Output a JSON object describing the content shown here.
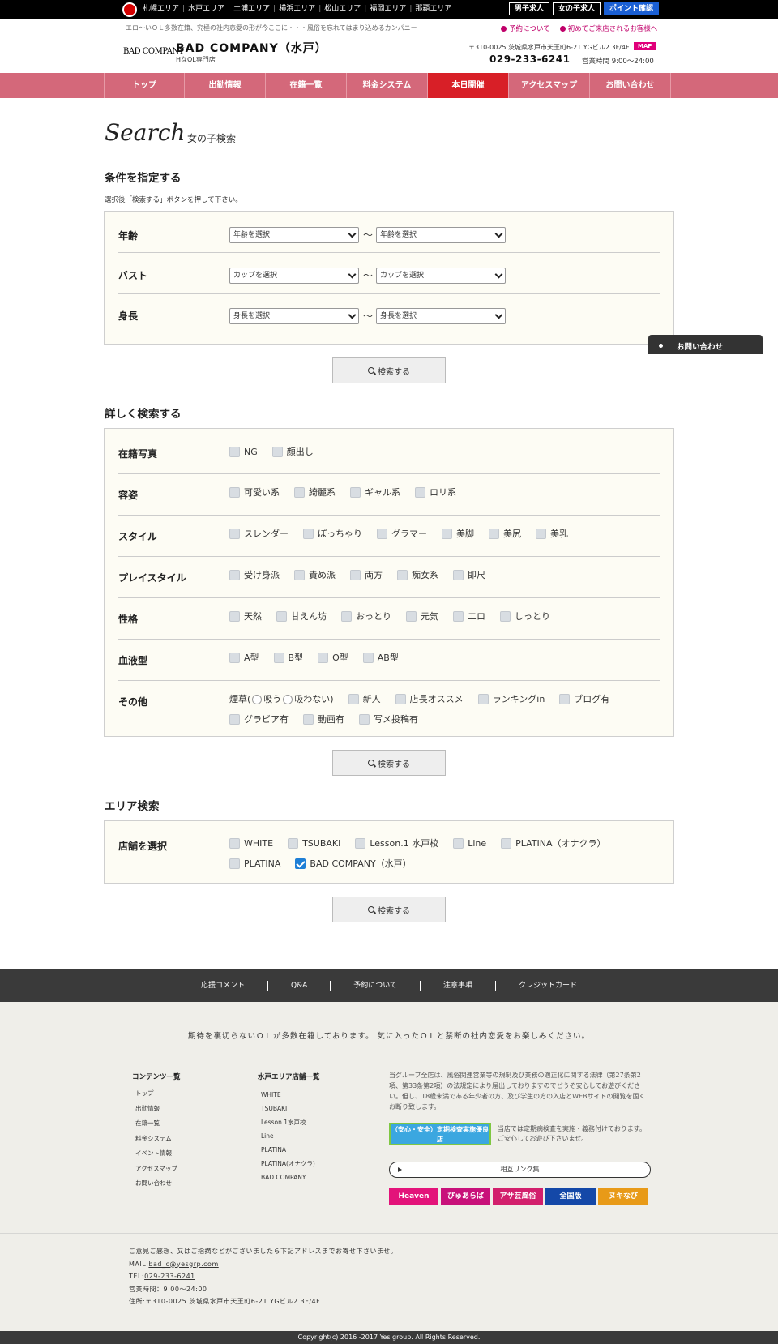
{
  "topbar": {
    "areas": [
      "札幌エリア",
      "水戸エリア",
      "土浦エリア",
      "横浜エリア",
      "松山エリア",
      "福岡エリア",
      "那覇エリア"
    ],
    "buttons": [
      "男子求人",
      "女の子求人",
      "ポイント確認"
    ]
  },
  "header": {
    "tagline": "エロ〜いＯＬ多数在籍、究極の社内恋愛の形が今ここに・・・風俗を忘れてはまり込めるカンパニー",
    "logo": "BAD COMPANY",
    "shop_name": "BAD COMPANY（水戸）",
    "shop_sub": "HなOL専門店",
    "link_reserve": "予約について",
    "link_first": "初めてご来店されるお客様へ",
    "address": "〒310-0025 茨城県水戸市天王町6-21 YGビル2 3F/4F",
    "map_label": "MAP",
    "phone": "029-233-6241",
    "hours": "営業時間  9:00〜24:00"
  },
  "nav": [
    "トップ",
    "出勤情報",
    "在籍一覧",
    "料金システム",
    "本日開催",
    "アクセスマップ",
    "お問い合わせ"
  ],
  "page": {
    "heading": "Search",
    "subheading": "女の子検索"
  },
  "basic_search": {
    "title": "条件を指定する",
    "note": "選択後「検索する」ボタンを押して下さい。",
    "rows": [
      {
        "label": "年齢",
        "from": "年齢を選択",
        "to": "年齢を選択"
      },
      {
        "label": "バスト",
        "from": "カップを選択",
        "to": "カップを選択"
      },
      {
        "label": "身長",
        "from": "身長を選択",
        "to": "身長を選択"
      }
    ],
    "tilde": "〜",
    "button": "検索する"
  },
  "inquiry_tab": "お問い合わせ",
  "detail_search": {
    "title": "詳しく検索する",
    "rows": [
      {
        "label": "在籍写真",
        "options": [
          "NG",
          "顔出し"
        ]
      },
      {
        "label": "容姿",
        "options": [
          "可愛い系",
          "綺麗系",
          "ギャル系",
          "ロリ系"
        ]
      },
      {
        "label": "スタイル",
        "options": [
          "スレンダー",
          "ぽっちゃり",
          "グラマー",
          "美脚",
          "美尻",
          "美乳"
        ]
      },
      {
        "label": "プレイスタイル",
        "options": [
          "受け身派",
          "責め派",
          "両方",
          "痴女系",
          "即尺"
        ]
      },
      {
        "label": "性格",
        "options": [
          "天然",
          "甘えん坊",
          "おっとり",
          "元気",
          "エロ",
          "しっとり"
        ]
      },
      {
        "label": "血液型",
        "options": [
          "A型",
          "B型",
          "O型",
          "AB型"
        ]
      }
    ],
    "other": {
      "label": "その他",
      "smoke_label": "煙草(",
      "smoke_yes": "吸う",
      "smoke_no": "吸わない)",
      "options": [
        "新人",
        "店長オススメ",
        "ランキングin",
        "ブログ有",
        "グラビア有",
        "動画有",
        "写メ投稿有"
      ]
    },
    "button": "検索する"
  },
  "area_search": {
    "title": "エリア検索",
    "label": "店舗を選択",
    "stores": [
      "WHITE",
      "TSUBAKI",
      "Lesson.1 水戸校",
      "Line",
      "PLATINA（オナクラ）",
      "PLATINA",
      "BAD COMPANY（水戸）"
    ],
    "checked_index": 6,
    "button": "検索する"
  },
  "footer_nav": [
    "応援コメント",
    "Q&A",
    "予約について",
    "注意事項",
    "クレジットカード"
  ],
  "footer": {
    "message": "期待を裏切らないＯＬが多数在籍しております。 気に入ったＯＬと禁断の社内恋愛をお楽しみください。",
    "contents_title": "コンテンツ一覧",
    "contents": [
      "トップ",
      "出勤情報",
      "在籍一覧",
      "料金システム",
      "イベント情報",
      "アクセスマップ",
      "お問い合わせ"
    ],
    "stores_title": "水戸エリア店舗一覧",
    "stores": [
      "WHITE",
      "TSUBAKI",
      "Lesson.1水戸校",
      "Line",
      "PLATINA",
      "PLATINA(オナクラ)",
      "BAD COMPANY"
    ],
    "legal": "当グループ全店は、風俗関連営業等の規制及び業務の適正化に関する法律（第27条第2項、第33条第2項）の法規定により届出しておりますのでどうぞ安心してお遊びください。但し、18歳未満である年少者の方、及び学生の方の入店とWEBサイトの閲覧を固くお断り致します。",
    "banner1": "（安心・安全）定期検査実施優良店",
    "banner1_text": "当店では定期病検査を実施・義務付けております。ご安心してお遊び下さいませ。",
    "mutual_link": "相互リンク集",
    "banners": [
      "Heaven",
      "ぴゅあらば",
      "アサ芸風俗",
      "全国版",
      "ヌキなび"
    ],
    "contact_intro": "ご意見ご感想、又はご指摘などがございましたら下記アドレスまでお寄せ下さいませ。",
    "mail_label": "MAIL:",
    "mail": "bad_c@yesgrp.com",
    "tel_label": "TEL:",
    "tel": "029-233-6241",
    "hours": "営業時間：9:00〜24:00",
    "address": "住所:〒310-0025 茨城県水戸市天王町6-21 YGビル2 3F/4F"
  },
  "copyright": "Copyright(c) 2016 -2017 Yes group. All Rights Reserved."
}
